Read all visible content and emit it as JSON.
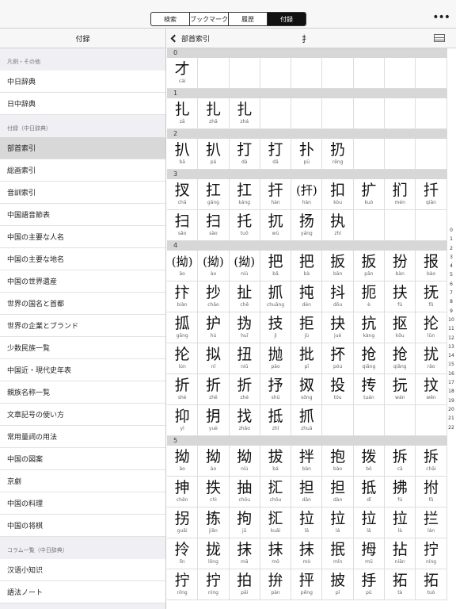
{
  "tabs": [
    "検索",
    "ブックマーク",
    "履歴",
    "付録"
  ],
  "active_tab": 3,
  "more_label": "•••",
  "sidebar": {
    "title": "付録",
    "sections": [
      {
        "label": "凡例・その他",
        "items": [
          "中日辞典",
          "日中辞典"
        ]
      },
      {
        "label": "付録（中日辞典）",
        "items": [
          "部首索引",
          "総画索引",
          "音訓索引",
          "中国語音節表",
          "中国の主要な人名",
          "中国の主要な地名",
          "中国の世界遺産",
          "世界の国名と首都",
          "世界の企業とブランド",
          "少数民族一覧",
          "中国近・現代史年表",
          "親族名称一覧",
          "文章記号の使い方",
          "常用量詞の用法",
          "中国の図案",
          "京劇",
          "中国の料理",
          "中国の将棋"
        ]
      },
      {
        "label": "コラム一覧（中日辞典）",
        "items": [
          "汉语小知识",
          "語法ノート"
        ]
      }
    ],
    "selected_item": "部首索引"
  },
  "main_header": {
    "back_label": "部首索引",
    "radical": "扌"
  },
  "groups": [
    {
      "stroke": "0",
      "chars": [
        [
          "才",
          "cái"
        ]
      ]
    },
    {
      "stroke": "1",
      "chars": [
        [
          "扎",
          "zā"
        ],
        [
          "扎",
          "zhā"
        ],
        [
          "扎",
          "zhá"
        ]
      ]
    },
    {
      "stroke": "2",
      "chars": [
        [
          "扒",
          "bā"
        ],
        [
          "扒",
          "pá"
        ],
        [
          "打",
          "dá"
        ],
        [
          "打",
          "dǎ"
        ],
        [
          "扑",
          "pū"
        ],
        [
          "扔",
          "rēng"
        ]
      ]
    },
    {
      "stroke": "3",
      "chars": [
        [
          "扠",
          "chā"
        ],
        [
          "扛",
          "gāng"
        ],
        [
          "扛",
          "káng"
        ],
        [
          "扞",
          "hàn"
        ],
        [
          "(扞)",
          "hàn"
        ],
        [
          "扣",
          "kòu"
        ],
        [
          "扩",
          "kuò"
        ],
        [
          "扪",
          "mén"
        ],
        [
          "扦",
          "qiān"
        ],
        [
          "扫",
          "sǎo"
        ],
        [
          "扫",
          "sào"
        ],
        [
          "托",
          "tuō"
        ],
        [
          "扤",
          "wù"
        ],
        [
          "扬",
          "yáng"
        ],
        [
          "执",
          "zhí"
        ]
      ]
    },
    {
      "stroke": "4",
      "chars": [
        [
          "(拗)",
          "ǎo"
        ],
        [
          "(拗)",
          "ào"
        ],
        [
          "(拗)",
          "niù"
        ],
        [
          "把",
          "bǎ"
        ],
        [
          "把",
          "bà"
        ],
        [
          "扳",
          "bān"
        ],
        [
          "扳",
          "pān"
        ],
        [
          "扮",
          "bàn"
        ],
        [
          "报",
          "bào"
        ],
        [
          "抃",
          "biàn"
        ],
        [
          "抄",
          "chāo"
        ],
        [
          "扯",
          "chě"
        ],
        [
          "抓",
          "chuāng"
        ],
        [
          "扽",
          "dèn"
        ],
        [
          "抖",
          "dǒu"
        ],
        [
          "扼",
          "è"
        ],
        [
          "扶",
          "fú"
        ],
        [
          "抚",
          "fǔ"
        ],
        [
          "㧓",
          "gāng"
        ],
        [
          "护",
          "hù"
        ],
        [
          "㧑",
          "huī"
        ],
        [
          "技",
          "jì"
        ],
        [
          "拒",
          "jù"
        ],
        [
          "抉",
          "jué"
        ],
        [
          "抗",
          "kàng"
        ],
        [
          "抠",
          "kōu"
        ],
        [
          "抡",
          "lūn"
        ],
        [
          "抡",
          "lún"
        ],
        [
          "拟",
          "nǐ"
        ],
        [
          "扭",
          "niǔ"
        ],
        [
          "抛",
          "pāo"
        ],
        [
          "批",
          "pī"
        ],
        [
          "抔",
          "póu"
        ],
        [
          "抢",
          "qiāng"
        ],
        [
          "抢",
          "qiǎng"
        ],
        [
          "扰",
          "rǎo"
        ],
        [
          "折",
          "shé"
        ],
        [
          "折",
          "zhē"
        ],
        [
          "折",
          "zhé"
        ],
        [
          "抒",
          "shū"
        ],
        [
          "㧐",
          "sǒng"
        ],
        [
          "投",
          "tóu"
        ],
        [
          "抟",
          "tuán"
        ],
        [
          "抏",
          "wán"
        ],
        [
          "抆",
          "wěn"
        ],
        [
          "抑",
          "yì"
        ],
        [
          "抈",
          "yuè"
        ],
        [
          "找",
          "zhǎo"
        ],
        [
          "抵",
          "zhǐ"
        ],
        [
          "抓",
          "zhuā"
        ]
      ]
    },
    {
      "stroke": "5",
      "chars": [
        [
          "拗",
          "ǎo"
        ],
        [
          "拗",
          "ào"
        ],
        [
          "拗",
          "niù"
        ],
        [
          "拔",
          "bá"
        ],
        [
          "拌",
          "bàn"
        ],
        [
          "抱",
          "bào"
        ],
        [
          "拨",
          "bō"
        ],
        [
          "拆",
          "cā"
        ],
        [
          "拆",
          "chāi"
        ],
        [
          "抻",
          "chēn"
        ],
        [
          "抶",
          "chì"
        ],
        [
          "抽",
          "chōu"
        ],
        [
          "㧟",
          "chōu"
        ],
        [
          "担",
          "dān"
        ],
        [
          "担",
          "dàn"
        ],
        [
          "抵",
          "dǐ"
        ],
        [
          "拂",
          "fú"
        ],
        [
          "拊",
          "fǔ"
        ],
        [
          "拐",
          "guǎi"
        ],
        [
          "拣",
          "jiǎn"
        ],
        [
          "拘",
          "jū"
        ],
        [
          "㧟",
          "kuǎi"
        ],
        [
          "拉",
          "lā"
        ],
        [
          "拉",
          "lá"
        ],
        [
          "拉",
          "lǎ"
        ],
        [
          "拉",
          "là"
        ],
        [
          "拦",
          "lán"
        ],
        [
          "拎",
          "līn"
        ],
        [
          "拢",
          "lǒng"
        ],
        [
          "抹",
          "mā"
        ],
        [
          "抹",
          "mǒ"
        ],
        [
          "抹",
          "mò"
        ],
        [
          "抿",
          "mǐn"
        ],
        [
          "拇",
          "mǔ"
        ],
        [
          "拈",
          "niān"
        ],
        [
          "拧",
          "níng"
        ],
        [
          "拧",
          "nǐng"
        ],
        [
          "拧",
          "nìng"
        ],
        [
          "拍",
          "pāi"
        ],
        [
          "拚",
          "pàn"
        ],
        [
          "抨",
          "pēng"
        ],
        [
          "披",
          "pī"
        ],
        [
          "抙",
          "pū"
        ],
        [
          "拓",
          "tà"
        ],
        [
          "拓",
          "tuò"
        ]
      ]
    }
  ],
  "index_numbers": [
    "0",
    "1",
    "2",
    "3",
    "4",
    "5",
    "6",
    "7",
    "8",
    "9",
    "10",
    "11",
    "12",
    "13",
    "14",
    "15",
    "16",
    "17",
    "18",
    "19",
    "20",
    "21",
    "22"
  ]
}
